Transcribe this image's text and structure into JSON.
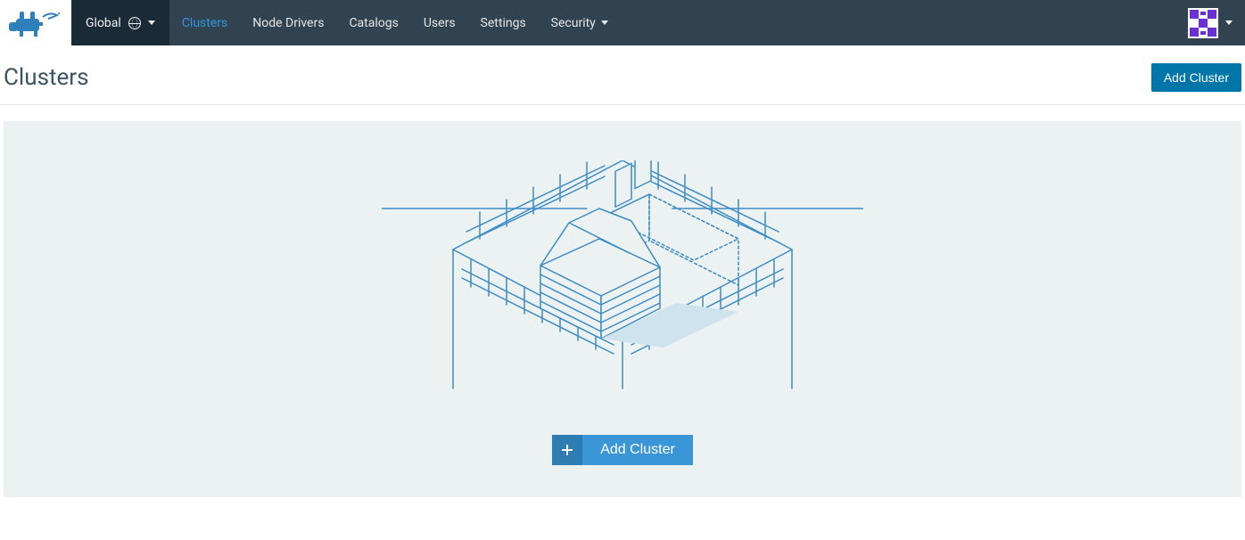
{
  "nav": {
    "scope_label": "Global",
    "items": [
      {
        "label": "Clusters",
        "active": true,
        "has_caret": false
      },
      {
        "label": "Node Drivers",
        "active": false,
        "has_caret": false
      },
      {
        "label": "Catalogs",
        "active": false,
        "has_caret": false
      },
      {
        "label": "Users",
        "active": false,
        "has_caret": false
      },
      {
        "label": "Settings",
        "active": false,
        "has_caret": false
      },
      {
        "label": "Security",
        "active": false,
        "has_caret": true
      }
    ]
  },
  "page": {
    "title": "Clusters",
    "add_button_label": "Add Cluster"
  },
  "empty_state": {
    "add_button_label": "Add Cluster"
  },
  "colors": {
    "navbar_bg": "#314351",
    "nav_active": "#3497da",
    "primary_btn": "#0075a8",
    "empty_bg": "#ecf1f2",
    "big_btn_plus": "#2d7db3",
    "big_btn_body": "#3a96d6",
    "illustration_stroke": "#3c8dc4"
  },
  "icons": {
    "globe": "globe-icon",
    "chevron_down": "chevron-down-icon",
    "plus": "plus-icon",
    "avatar": "avatar-icon",
    "logo": "rancher-logo"
  }
}
